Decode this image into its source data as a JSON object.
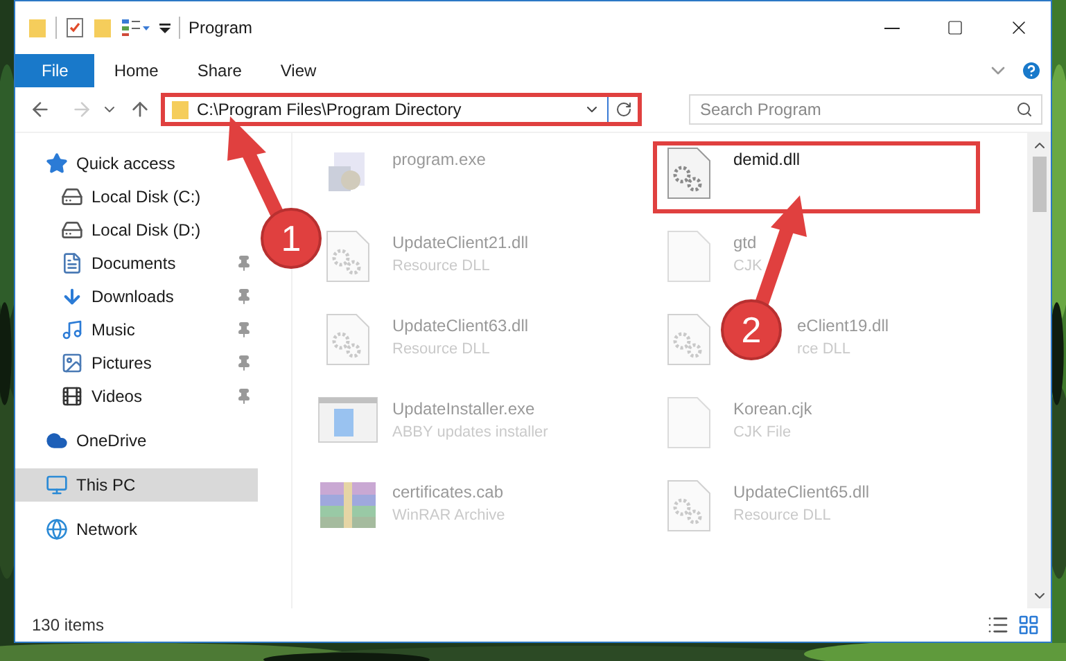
{
  "window": {
    "title": "Program"
  },
  "ribbon": {
    "tabs": [
      {
        "label": "File",
        "selected": true
      },
      {
        "label": "Home",
        "selected": false
      },
      {
        "label": "Share",
        "selected": false
      },
      {
        "label": "View",
        "selected": false
      }
    ]
  },
  "address": {
    "path": "C:\\Program Files\\Program Directory",
    "highlighted": true
  },
  "search": {
    "placeholder": "Search Program"
  },
  "sidebar": {
    "items": [
      {
        "label": "Quick access",
        "kind": "star",
        "pinned": false,
        "selected": false
      },
      {
        "label": "Local Disk (C:)",
        "kind": "disk",
        "pinned": false,
        "selected": false
      },
      {
        "label": "Local Disk (D:)",
        "kind": "disk",
        "pinned": false,
        "selected": false
      },
      {
        "label": "Documents",
        "kind": "documents",
        "pinned": true,
        "selected": false
      },
      {
        "label": "Downloads",
        "kind": "downloads",
        "pinned": true,
        "selected": false
      },
      {
        "label": "Music",
        "kind": "music",
        "pinned": true,
        "selected": false
      },
      {
        "label": "Pictures",
        "kind": "pictures",
        "pinned": true,
        "selected": false
      },
      {
        "label": "Videos",
        "kind": "videos",
        "pinned": true,
        "selected": false
      },
      {
        "label": "OneDrive",
        "kind": "cloud",
        "pinned": false,
        "selected": false
      },
      {
        "label": "This PC",
        "kind": "pc",
        "pinned": false,
        "selected": true
      },
      {
        "label": "Network",
        "kind": "network",
        "pinned": false,
        "selected": false
      }
    ]
  },
  "files": [
    {
      "name": "program.exe",
      "kind": "exe",
      "dimmed": true,
      "highlighted": false,
      "covered": false
    },
    {
      "name": "demid.dll",
      "kind": "dll",
      "dimmed": false,
      "highlighted": true,
      "covered": false
    },
    {
      "name": "UpdateClient21.dll",
      "type": "Resource DLL",
      "kind": "dll",
      "dimmed": true,
      "highlighted": false,
      "covered": false
    },
    {
      "name": "gtd",
      "type": "CJK",
      "kind": "file",
      "dimmed": true,
      "highlighted": false,
      "covered": false
    },
    {
      "name": "UpdateClient63.dll",
      "type": "Resource DLL",
      "kind": "dll",
      "dimmed": true,
      "highlighted": false,
      "covered": false
    },
    {
      "name": "eClient19.dll",
      "type": "rce DLL",
      "kind": "dll",
      "dimmed": true,
      "highlighted": false,
      "covered": true
    },
    {
      "name": "UpdateInstaller.exe",
      "type": "ABBY updates installer",
      "kind": "installer",
      "dimmed": true,
      "highlighted": false,
      "covered": false
    },
    {
      "name": "Korean.cjk",
      "type": "CJK File",
      "kind": "file",
      "dimmed": true,
      "highlighted": false,
      "covered": false
    },
    {
      "name": "certificates.cab",
      "type": "WinRAR Archive",
      "kind": "archive",
      "dimmed": true,
      "highlighted": false,
      "covered": false
    },
    {
      "name": "UpdateClient65.dll",
      "type": "Resource DLL",
      "kind": "dll",
      "dimmed": true,
      "highlighted": false,
      "covered": false
    }
  ],
  "annotations": [
    {
      "label": "1"
    },
    {
      "label": "2"
    }
  ],
  "status_bar": {
    "count": "130 items"
  }
}
